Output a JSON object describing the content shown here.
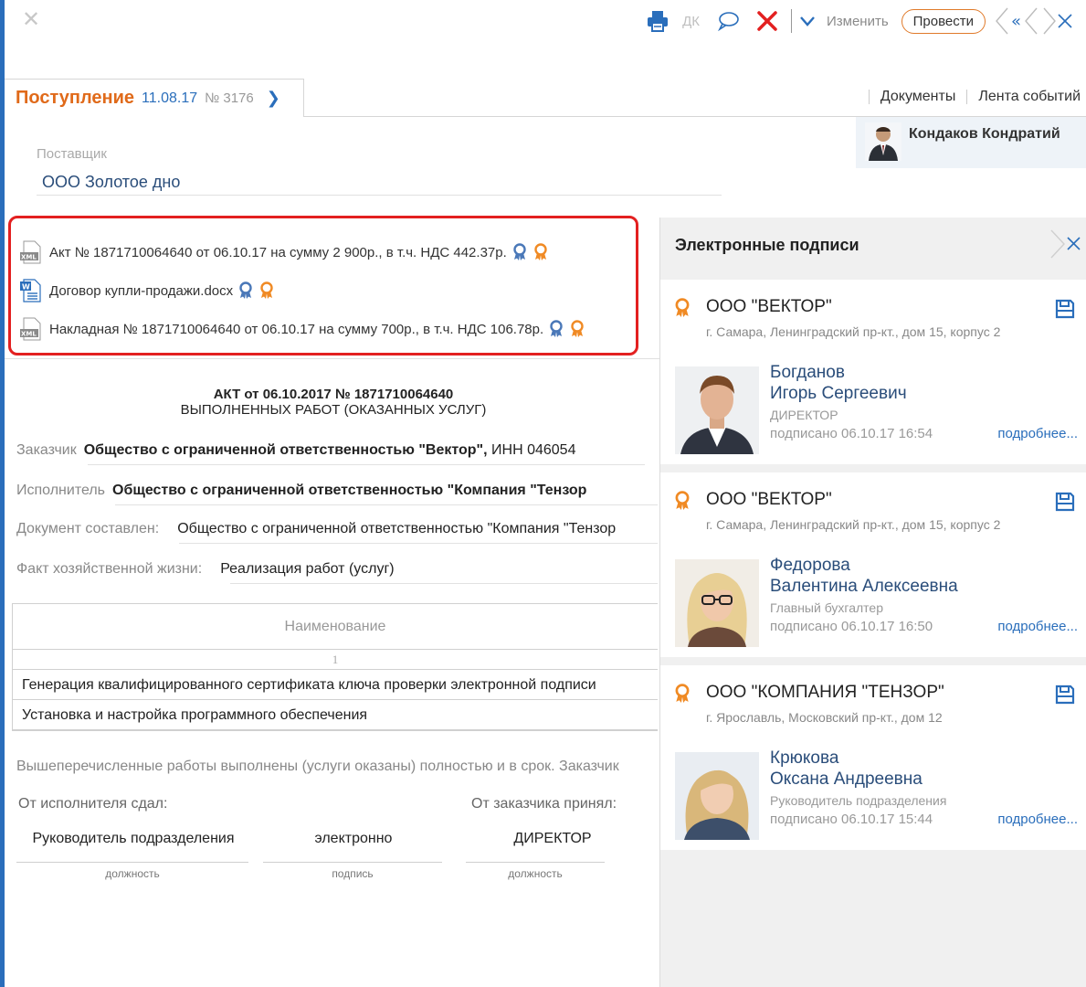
{
  "toolbar": {
    "dk_label": "ДК",
    "edit_label": "Изменить",
    "run_label": "Провести"
  },
  "doc": {
    "type": "Поступление",
    "date": "11.08.17",
    "number": "№ 3176"
  },
  "top_links": [
    "Документы",
    "Лента событий"
  ],
  "user": {
    "name": "Кондаков Кондратий"
  },
  "supplier": {
    "label": "Поставщик",
    "value": "ООО Золотое дно"
  },
  "attachments": [
    {
      "type": "xml",
      "name": "Акт № 1871710064640 от 06.10.17 на сумму 2 900р., в т.ч. НДС 442.37р."
    },
    {
      "type": "docx",
      "name": "Договор купли-продажи.docx"
    },
    {
      "type": "xml",
      "name": "Накладная № 1871710064640 от 06.10.17 на сумму 700р., в т.ч. НДС 106.78р."
    }
  ],
  "act": {
    "title1": "АКТ от 06.10.2017 № 1871710064640",
    "title2": "ВЫПОЛНЕННЫХ РАБОТ (ОКАЗАННЫХ УСЛУГ)",
    "customer_label": "Заказчик",
    "customer_value": "Общество с ограниченной ответственностью \"Вектор\",",
    "customer_inn": "ИНН 046054",
    "executor_label": "Исполнитель",
    "executor_value": "Общество с ограниченной ответственностью \"Компания \"Тензор",
    "composed_label": "Документ составлен:",
    "composed_value": "Общество с ограниченной ответственностью \"Компания \"Тензор",
    "fact_label": "Факт хозяйственной жизни:",
    "fact_value": "Реализация работ (услуг)",
    "table_header": "Наименование",
    "table_colnum": "1",
    "rows": [
      "Генерация квалифицированного сертификата ключа проверки электронной подписи",
      "Установка и настройка программного обеспечения"
    ],
    "footer_text": "Вышеперечисленные работы выполнены (услуги оказаны) полностью и в срок. Заказчик",
    "from_executor": "От исполнителя сдал:",
    "from_customer": "От заказчика принял:",
    "sig1_value": "Руководитель подразделения",
    "sig2_value": "электронно",
    "sig3_value": "ДИРЕКТОР",
    "sig1_cap": "должность",
    "sig2_cap": "подпись",
    "sig3_cap": "должность"
  },
  "panel": {
    "title": "Электронные подписи",
    "signatures": [
      {
        "org": "ООО \"ВЕКТОР\"",
        "address": "г. Самара, Ленинградский пр-кт., дом 15, корпус 2",
        "last_name": "Богданов",
        "first_names": "Игорь Сергеевич",
        "position": "ДИРЕКТОР",
        "signed": "подписано 06.10.17 16:54",
        "more": "подробнее..."
      },
      {
        "org": "ООО \"ВЕКТОР\"",
        "address": "г. Самара, Ленинградский пр-кт., дом 15, корпус 2",
        "last_name": "Федорова",
        "first_names": "Валентина Алексеевна",
        "position": "Главный бухгалтер",
        "signed": "подписано 06.10.17 16:50",
        "more": "подробнее..."
      },
      {
        "org": "ООО \"КОМПАНИЯ \"ТЕНЗОР\"",
        "address": "г. Ярославль, Московский пр-кт., дом 12",
        "last_name": "Крюкова",
        "first_names": "Оксана Андреевна",
        "position": "Руководитель подразделения",
        "signed": "подписано 06.10.17 15:44",
        "more": "подробнее..."
      }
    ]
  },
  "icons": {
    "print": "printer-icon",
    "comment": "speech-bubble-icon",
    "delete": "red-cross-icon",
    "dropdown": "chevron-down-icon",
    "nav_back": "double-chevron-left-icon",
    "nav_close": "chevron-close-icon",
    "seal": "rosette-icon",
    "save": "floppy-disk-icon"
  },
  "colors": {
    "accent_orange": "#e06a1a",
    "link_blue": "#2a6ebb",
    "highlight_red": "#e32020",
    "seal_blue": "#4a78b8",
    "seal_orange": "#f08a24"
  }
}
